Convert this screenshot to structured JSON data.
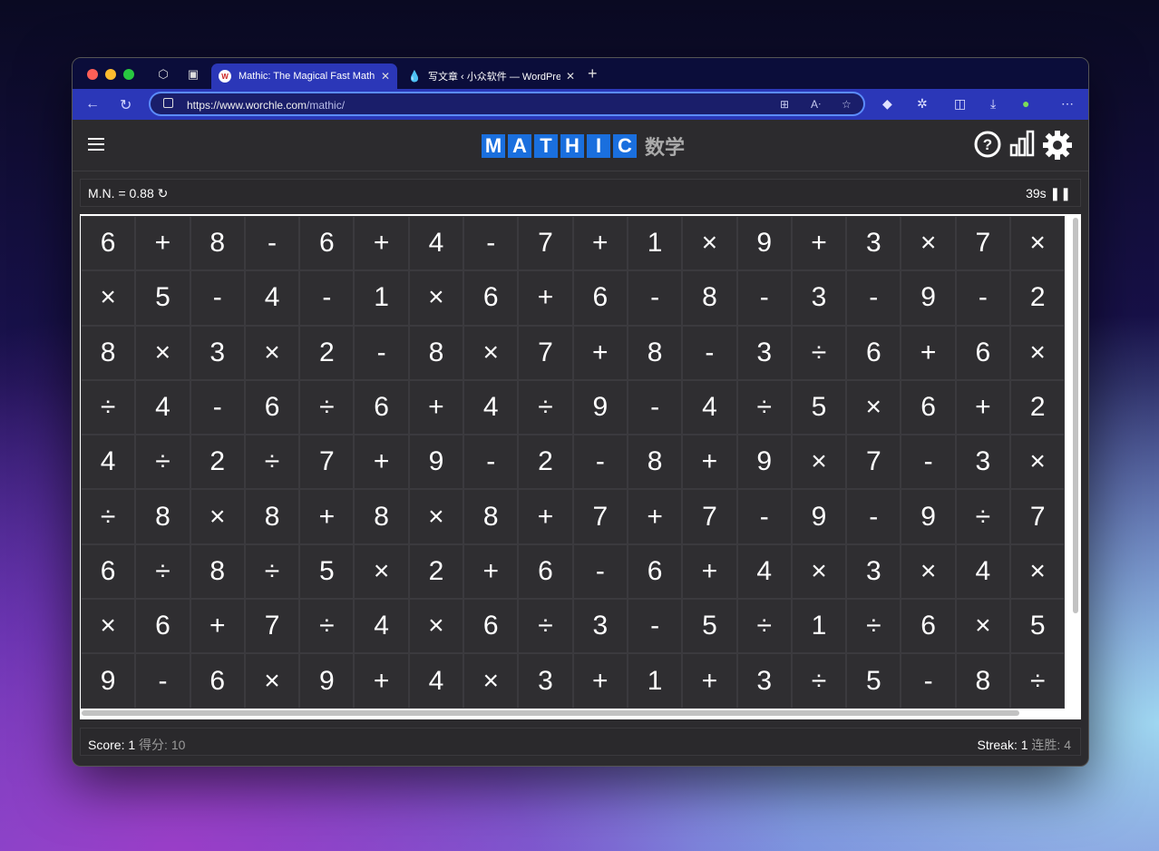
{
  "browser": {
    "tabs": [
      {
        "title": "Mathic: The Magical Fast Math",
        "favicon": "W",
        "active": true
      },
      {
        "title": "写文章 ‹ 小众软件 — WordPress",
        "favicon": "drop-icon",
        "active": false
      }
    ],
    "url": {
      "host": "https://www.worchle.com",
      "path": "/mathic/"
    }
  },
  "app": {
    "logo_letters": [
      "M",
      "A",
      "T",
      "H",
      "I",
      "C"
    ],
    "logo_cn": "数学",
    "mn_label": "M.N. = 0.88",
    "timer": "39s",
    "score_label": "Score:",
    "score_value": "1",
    "score_cn": "得分:",
    "score_cn_value": "10",
    "streak_label": "Streak:",
    "streak_value": "1",
    "streak_cn": "连胜:",
    "streak_cn_value": "4"
  },
  "grid": [
    [
      "6",
      "+",
      "8",
      "-",
      "6",
      "+",
      "4",
      "-",
      "7",
      "+",
      "1",
      "×",
      "9",
      "+",
      "3",
      "×",
      "7",
      "×"
    ],
    [
      "×",
      "5",
      "-",
      "4",
      "-",
      "1",
      "×",
      "6",
      "+",
      "6",
      "-",
      "8",
      "-",
      "3",
      "-",
      "9",
      "-",
      "2"
    ],
    [
      "8",
      "×",
      "3",
      "×",
      "2",
      "-",
      "8",
      "×",
      "7",
      "+",
      "8",
      "-",
      "3",
      "÷",
      "6",
      "+",
      "6",
      "×"
    ],
    [
      "÷",
      "4",
      "-",
      "6",
      "÷",
      "6",
      "+",
      "4",
      "÷",
      "9",
      "-",
      "4",
      "÷",
      "5",
      "×",
      "6",
      "+",
      "2"
    ],
    [
      "4",
      "÷",
      "2",
      "÷",
      "7",
      "+",
      "9",
      "-",
      "2",
      "-",
      "8",
      "+",
      "9",
      "×",
      "7",
      "-",
      "3",
      "×"
    ],
    [
      "÷",
      "8",
      "×",
      "8",
      "+",
      "8",
      "×",
      "8",
      "+",
      "7",
      "+",
      "7",
      "-",
      "9",
      "-",
      "9",
      "÷",
      "7"
    ],
    [
      "6",
      "÷",
      "8",
      "÷",
      "5",
      "×",
      "2",
      "+",
      "6",
      "-",
      "6",
      "+",
      "4",
      "×",
      "3",
      "×",
      "4",
      "×"
    ],
    [
      "×",
      "6",
      "+",
      "7",
      "÷",
      "4",
      "×",
      "6",
      "÷",
      "3",
      "-",
      "5",
      "÷",
      "1",
      "÷",
      "6",
      "×",
      "5"
    ],
    [
      "9",
      "-",
      "6",
      "×",
      "9",
      "+",
      "4",
      "×",
      "3",
      "+",
      "1",
      "+",
      "3",
      "÷",
      "5",
      "-",
      "8",
      "÷"
    ]
  ]
}
